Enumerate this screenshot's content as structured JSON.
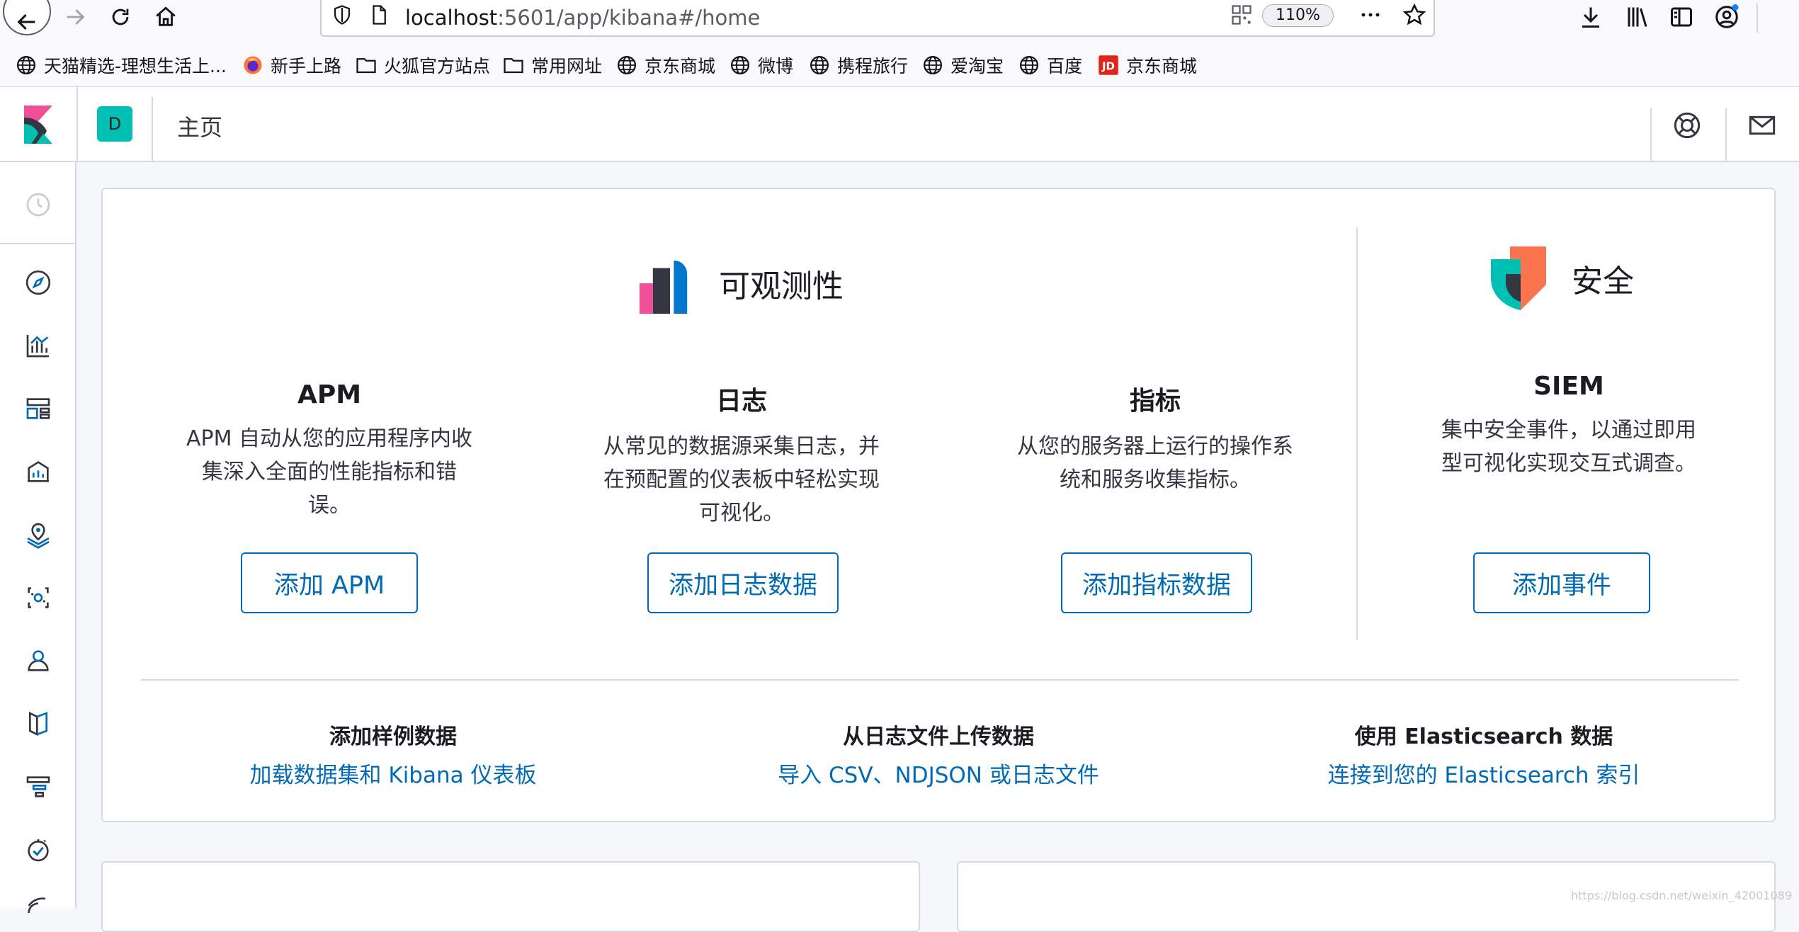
{
  "browser": {
    "url_host": "localhost",
    "url_path": ":5601/app/kibana#/home",
    "zoom": "110%",
    "bookmarks": [
      {
        "label": "天猫精选-理想生活上...",
        "icon": "globe-icon"
      },
      {
        "label": "新手上路",
        "icon": "firefox-icon"
      },
      {
        "label": "火狐官方站点",
        "icon": "folder-icon"
      },
      {
        "label": "常用网址",
        "icon": "folder-icon"
      },
      {
        "label": "京东商城",
        "icon": "globe-icon"
      },
      {
        "label": "微博",
        "icon": "globe-icon"
      },
      {
        "label": "携程旅行",
        "icon": "globe-icon"
      },
      {
        "label": "爱淘宝",
        "icon": "globe-icon"
      },
      {
        "label": "百度",
        "icon": "globe-icon"
      },
      {
        "label": "京东商城",
        "icon": "jd-icon"
      }
    ]
  },
  "header": {
    "space_initial": "D",
    "title": "主页"
  },
  "solutions": {
    "observability": {
      "title": "可观测性",
      "features": [
        {
          "title": "APM",
          "desc": "APM 自动从您的应用程序内收集深入全面的性能指标和错误。",
          "button": "添加 APM"
        },
        {
          "title": "日志",
          "desc": "从常见的数据源采集日志，并在预配置的仪表板中轻松实现可视化。",
          "button": "添加日志数据"
        },
        {
          "title": "指标",
          "desc": "从您的服务器上运行的操作系统和服务收集指标。",
          "button": "添加指标数据"
        }
      ]
    },
    "security": {
      "title": "安全",
      "feature": {
        "title": "SIEM",
        "desc": "集中安全事件，以通过即用型可视化实现交互式调查。",
        "button": "添加事件"
      }
    }
  },
  "data_sources": [
    {
      "title": "添加样例数据",
      "link": "加载数据集和 Kibana 仪表板"
    },
    {
      "title": "从日志文件上传数据",
      "link": "导入 CSV、NDJSON 或日志文件"
    },
    {
      "title": "使用 Elasticsearch 数据",
      "link": "连接到您的 Elasticsearch 索引"
    }
  ],
  "colors": {
    "accent": "#006bb4",
    "space_avatar": "#00bfb3",
    "observability_pink": "#f04e98",
    "observability_blue": "#0077cc",
    "security_orange": "#fa744e",
    "security_teal": "#00bfb3"
  },
  "watermark": "https://blog.csdn.net/weixin_42001089"
}
